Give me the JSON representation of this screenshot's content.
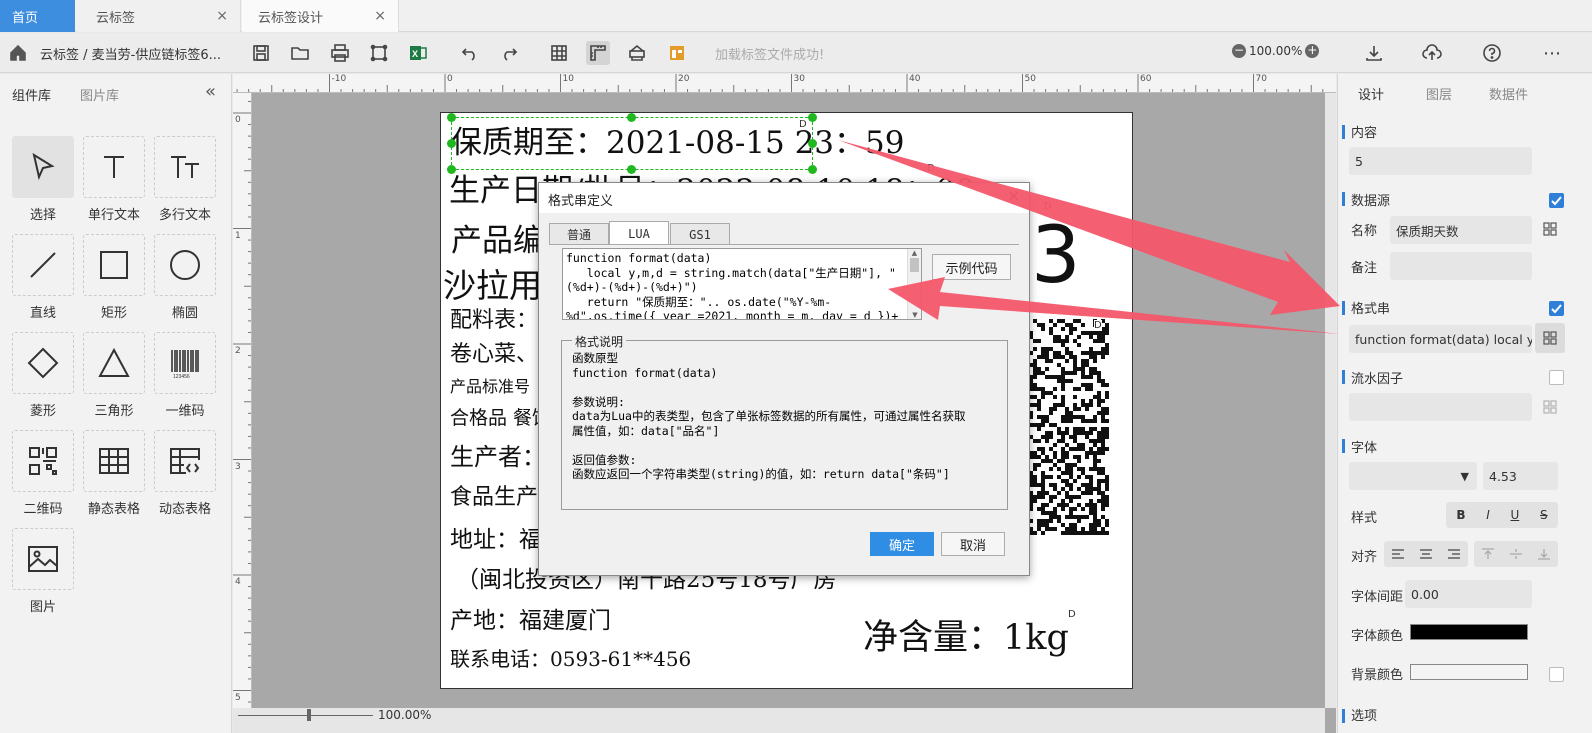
{
  "tabs": [
    {
      "label": "首页",
      "active": true
    },
    {
      "label": "云标签",
      "close": "×"
    },
    {
      "label": "云标签设计",
      "close": "×"
    }
  ],
  "toolbar": {
    "breadcrumb": "云标签 / 麦当劳-供应链标签6...",
    "status": "加载标签文件成功!",
    "zoom": "100.00%"
  },
  "left": {
    "tabs": [
      "组件库",
      "图片库"
    ],
    "collapse": "«",
    "components": [
      {
        "label": "选择",
        "icon": "cursor-icon"
      },
      {
        "label": "单行文本",
        "icon": "text-icon"
      },
      {
        "label": "多行文本",
        "icon": "multiline-text-icon"
      },
      {
        "label": "直线",
        "icon": "line-icon"
      },
      {
        "label": "矩形",
        "icon": "rectangle-icon"
      },
      {
        "label": "椭圆",
        "icon": "ellipse-icon"
      },
      {
        "label": "菱形",
        "icon": "diamond-icon"
      },
      {
        "label": "三角形",
        "icon": "triangle-icon"
      },
      {
        "label": "一维码",
        "icon": "barcode-icon"
      },
      {
        "label": "二维码",
        "icon": "qrcode-icon"
      },
      {
        "label": "静态表格",
        "icon": "table-icon"
      },
      {
        "label": "动态表格",
        "icon": "dynamic-table-icon"
      },
      {
        "label": "图片",
        "icon": "image-icon"
      }
    ]
  },
  "ruler": {
    "top": [
      "-10",
      "0",
      "10",
      "20",
      "30",
      "40",
      "50",
      "60",
      "70"
    ],
    "left": [
      "0",
      "1",
      "2",
      "3",
      "4",
      "5"
    ],
    "bottom_zoom": "100.00%"
  },
  "label": {
    "lines": [
      "保质期至：2021-08-15 23：59",
      "生产日期/批号：2022-08-10 18：00",
      "产品编码",
      "沙拉用",
      "配料表：",
      "卷心菜、",
      "产品标准号",
      "合格品  餐饮",
      "生产者：",
      "食品生产",
      "地址：福",
      "（闽北投资区）南十路25号18号厂房",
      "产地：福建厦门",
      "联系电话：0593-61**456",
      "净含量：1kg",
      "3"
    ],
    "marker": "D"
  },
  "dialog": {
    "title": "格式串定义",
    "close": "×",
    "tabs": [
      "普通",
      "LUA",
      "GS1"
    ],
    "code": "function format(data)\n   local y,m,d = string.match(data[\"生产日期\"], \"(%d+)-(%d+)-(%d+)\")\n   return \"保质期至：\".. os.date(\"%Y-%m-%d\",os.time({ year =2021, month = m, day = d })+",
    "example_button": "示例代码",
    "format_group": "格式说明",
    "desc": "函数原型\nfunction format(data)\n\n参数说明:\ndata为Lua中的表类型，包含了单张标签数据的所有属性，可通过属性名获取\n属性值，如：data[\"品名\"]\n\n返回值参数:\n函数应返回一个字符串类型(string)的值，如：return data[\"条码\"]",
    "ok": "确定",
    "cancel": "取消"
  },
  "right": {
    "tabs": [
      "设计",
      "图层",
      "数据件"
    ],
    "content_title": "内容",
    "content_value": "5",
    "datasource_title": "数据源",
    "name_label": "名称",
    "name_value": "保质期天数",
    "note_label": "备注",
    "note_value": "",
    "format_title": "格式串",
    "format_value": "function format(data)   local y,m,d",
    "serial_title": "流水因子",
    "font_title": "字体",
    "font_size": "4.53",
    "style_label": "样式",
    "style_buttons": [
      "B",
      "I",
      "U",
      "S"
    ],
    "align_label": "对齐",
    "spacing_label": "字体间距",
    "spacing_value": "0.00",
    "color_label": "字体颜色",
    "bg_label": "背景颜色",
    "options_title": "选项",
    "font_color": "#000000",
    "bg_color": "#f4f4f4"
  },
  "colors": {
    "accent": "#2f7fd8",
    "arrow": "#f4566a",
    "active_tab": "#3d8ede",
    "handle": "#1fb81f"
  }
}
